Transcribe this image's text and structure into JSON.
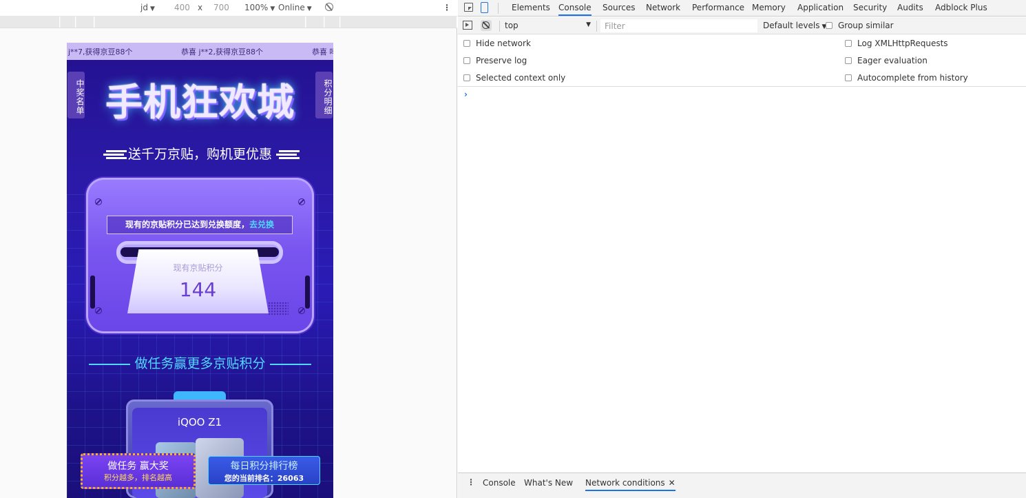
{
  "device_toolbar": {
    "device": "jd",
    "width": "400",
    "times": "x",
    "height": "700",
    "zoom": "100%",
    "network": "Online"
  },
  "page": {
    "ticker_1": "j**7,获得京豆88个",
    "ticker_2": "恭喜 j**2,获得京豆88个",
    "ticker_3": "恭喜 吗",
    "side_left": "中奖名单",
    "side_right": "积分明细",
    "title": "手机狂欢城",
    "subtitle": "送千万京贴，购机更优惠",
    "exchange_text": "现有的京贴积分已达到兑换额度，",
    "exchange_link": "去兑换",
    "points_label": "现有京贴积分",
    "points_value": "144",
    "task_heading": "做任务赢更多京贴积分",
    "product_name": "iQOO Z1",
    "task_button_line1": "做任务 赢大奖",
    "task_button_line2": "积分越多，排名越高",
    "rank_button_line1": "每日积分排行榜",
    "rank_button_line2": "您的当前排名：26063"
  },
  "devtools": {
    "tabs": [
      "Elements",
      "Console",
      "Sources",
      "Network",
      "Performance",
      "Memory",
      "Application",
      "Security",
      "Audits",
      "Adblock Plus"
    ],
    "active_tab": "Console",
    "context": "top",
    "filter_placeholder": "Filter",
    "levels": "Default levels",
    "group_similar": "Group similar",
    "settings": {
      "hide_network": "Hide network",
      "preserve_log": "Preserve log",
      "selected_context": "Selected context only",
      "log_xhr": "Log XMLHttpRequests",
      "eager_eval": "Eager evaluation",
      "autocomplete": "Autocomplete from history"
    },
    "drawer_tabs": [
      "Console",
      "What's New",
      "Network conditions"
    ],
    "drawer_active": "Network conditions"
  },
  "colors": {
    "accent": "#1a73e8",
    "page_bg": "#2b1aa8",
    "cyan": "#52d8ff",
    "gold": "#ffb21a"
  }
}
